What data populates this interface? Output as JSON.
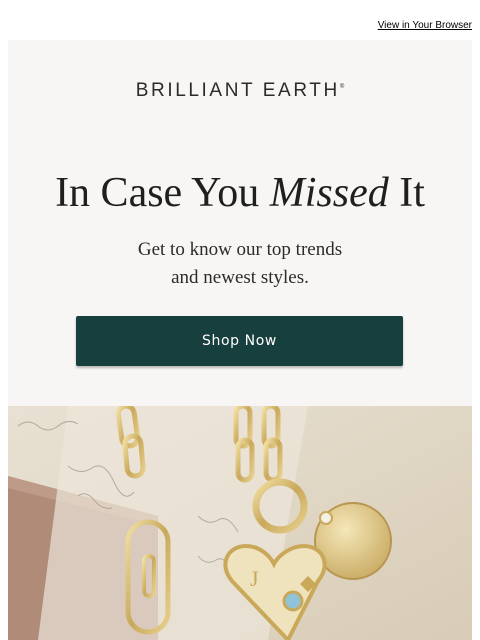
{
  "header": {
    "view_in_browser": "View in Your Browser"
  },
  "hero": {
    "brand": "BRILLIANT EARTH",
    "brand_mark": "®",
    "headline_prefix": "In Case You ",
    "headline_emphasis": "Missed",
    "headline_suffix": " It",
    "subtext_line1": "Get to know our top trends",
    "subtext_line2": "and newest styles.",
    "cta_label": "Shop Now"
  },
  "colors": {
    "button": "#173f3d",
    "hero_background": "#f7f6f4",
    "gold": "#d9c27c"
  },
  "image": {
    "subject": "gold-chain-necklaces-with-heart-charm"
  }
}
